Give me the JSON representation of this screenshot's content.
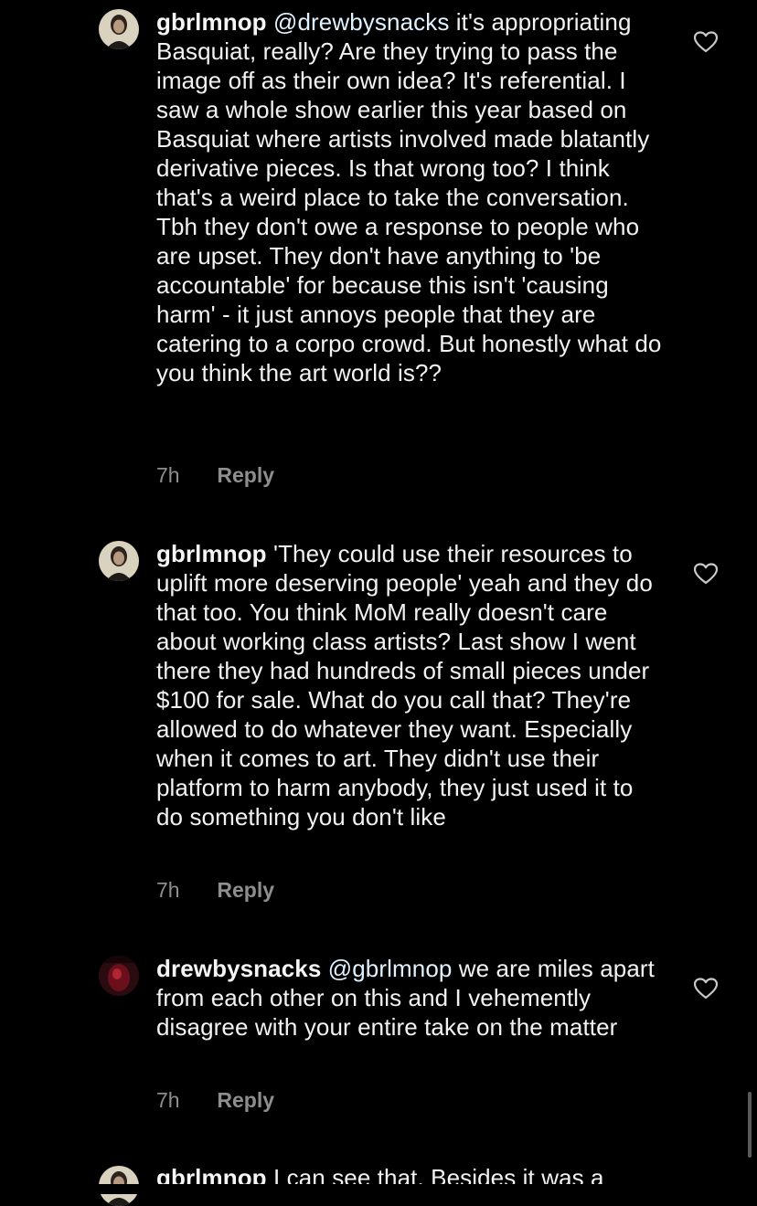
{
  "comments": [
    {
      "username": "gbrlmnop",
      "mention": "@drewbysnacks",
      "text": "it's appropriating Basquiat, really? Are they trying to pass the image off as their own idea? It's referential. I saw a whole show earlier this year based on Basquiat where artists involved made blatantly derivative pieces. Is that wrong too? I think that's a weird place to take the conversation. Tbh they don't owe a response to people who are upset. They don't have anything to 'be accountable' for because this isn't 'causing harm' - it just annoys people that they are catering to a corpo crowd. But honestly what do you think the art world is??",
      "time": "7h",
      "reply_label": "Reply"
    },
    {
      "username": "gbrlmnop",
      "mention": "",
      "text": "'They could use their resources to uplift more deserving people' yeah and they do that too. You think MoM really doesn't care about working class artists? Last show I went there they had hundreds of small pieces under $100 for sale. What do you call that? They're allowed to do whatever they want. Especially when it comes to art. They didn't use their platform to harm anybody, they just used it to do something you don't like",
      "time": "7h",
      "reply_label": "Reply"
    },
    {
      "username": "drewbysnacks",
      "mention": "@gbrlmnop",
      "text": "we are miles apart from each other on this and I vehemently disagree with your entire take on the matter",
      "time": "7h",
      "reply_label": "Reply"
    },
    {
      "username": "gbrlmnop",
      "mention": "",
      "text": "I can see that. Besides it was a",
      "time": "",
      "reply_label": ""
    }
  ],
  "colors": {
    "background": "#000000",
    "text": "#f2f2f2",
    "mention": "#e0f1ff",
    "meta": "#8e8e8e"
  },
  "icons": {
    "like": "heart-outline-icon",
    "avatar_gbrlmnop": "profile-photo",
    "avatar_drewbysnacks": "profile-photo"
  }
}
